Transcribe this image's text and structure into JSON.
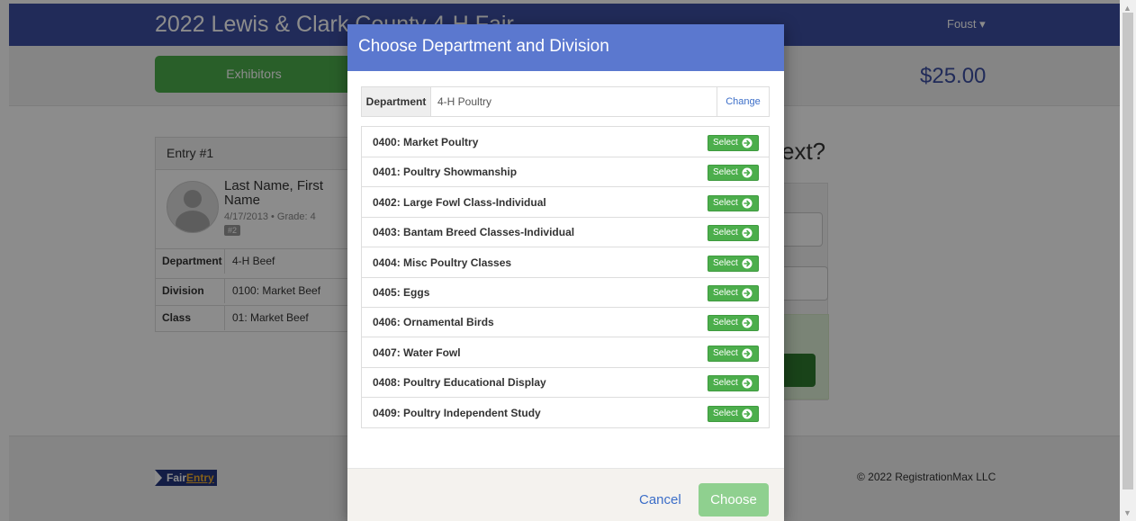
{
  "app": {
    "title": "2022 Lewis & Clark County 4-H Fair",
    "user": "Foust ▾"
  },
  "subbar": {
    "tab_exhibitors": "Exhibitors",
    "total": "$25.00"
  },
  "entry": {
    "header": "Entry #1",
    "name": "Last Name, First Name",
    "dob_grade": "4/17/2013 • Grade: 4",
    "badge": "#2",
    "rows": [
      {
        "key": "Department",
        "value": "4-H Beef"
      },
      {
        "key": "Division",
        "value": "0100: Market Beef"
      },
      {
        "key": "Class",
        "value": "01: Market Beef"
      }
    ]
  },
  "background": {
    "heading_fragment": "ext?"
  },
  "footer": {
    "logo_fair": "Fair",
    "logo_entry": "Entry",
    "copyright": "© 2022 RegistrationMax LLC"
  },
  "modal": {
    "title": "Choose Department and Division",
    "department_label": "Department",
    "department_value": "4-H Poultry",
    "change_label": "Change",
    "select_label": "Select",
    "divisions": [
      {
        "label": "0400: Market Poultry"
      },
      {
        "label": "0401: Poultry Showmanship"
      },
      {
        "label": "0402: Large Fowl Class-Individual"
      },
      {
        "label": "0403: Bantam Breed Classes-Individual"
      },
      {
        "label": "0404: Misc Poultry Classes"
      },
      {
        "label": "0405: Eggs"
      },
      {
        "label": "0406: Ornamental Birds"
      },
      {
        "label": "0407: Water Fowl"
      },
      {
        "label": "0408: Poultry Educational Display"
      },
      {
        "label": "0409: Poultry Independent Study"
      }
    ],
    "cancel_label": "Cancel",
    "choose_label": "Choose"
  },
  "icons": {
    "select_arrow": "circle-arrow-right-icon",
    "user_caret": "caret-down-icon",
    "avatar": "user-silhouette-icon"
  },
  "colors": {
    "navbar": "#3c4fa3",
    "modal_header": "#5b78cf",
    "success": "#4cae4c",
    "link": "#3c6ec8"
  }
}
